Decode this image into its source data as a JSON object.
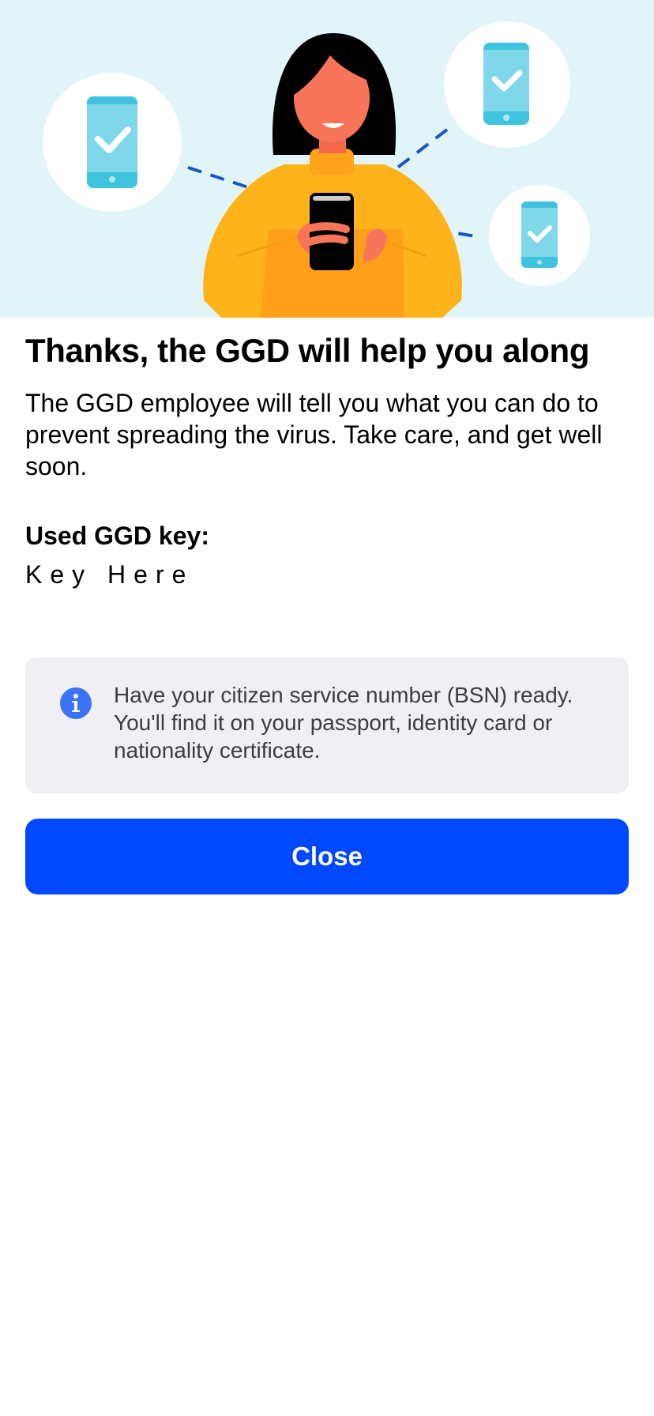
{
  "colors": {
    "hero_background": "#e1f4f7",
    "primary_button": "#0048ff",
    "info_background": "#efeff4",
    "info_icon": "#3b72f6"
  },
  "hero": {
    "illustration": "woman-using-phone-notifying-contacts",
    "icons": [
      "phone-check-icon",
      "phone-check-icon",
      "phone-check-icon"
    ]
  },
  "main": {
    "title": "Thanks, the GGD will help you along",
    "body": "The GGD employee will tell you what you can do to prevent spreading the virus. Take care, and get well soon.",
    "key_label": "Used GGD key:",
    "key_value": "Key Here"
  },
  "info": {
    "icon": "info-icon",
    "text": "Have your citizen service number (BSN) ready. You'll find it on your passport, identity card or nationality certificate."
  },
  "actions": {
    "close_label": "Close"
  }
}
